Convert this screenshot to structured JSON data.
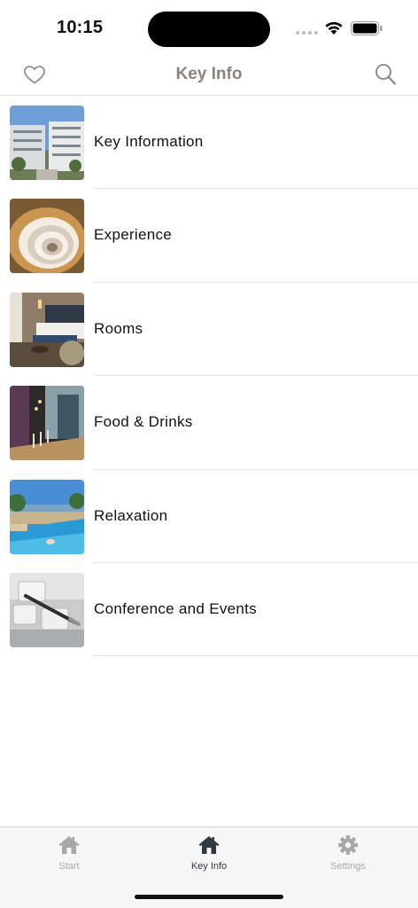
{
  "status_bar": {
    "time": "10:15"
  },
  "nav": {
    "title": "Key Info",
    "favorite_icon": "heart-outline-icon",
    "search_icon": "search-icon"
  },
  "list": {
    "items": [
      {
        "label": "Key Information",
        "thumbnail": "hotel-building-photo"
      },
      {
        "label": "Experience",
        "thumbnail": "spiral-staircase-photo"
      },
      {
        "label": "Rooms",
        "thumbnail": "hotel-room-photo"
      },
      {
        "label": "Food & Drinks",
        "thumbnail": "restaurant-photo"
      },
      {
        "label": "Relaxation",
        "thumbnail": "pool-photo"
      },
      {
        "label": "Conference and Events",
        "thumbnail": "keyboard-pen-photo"
      }
    ]
  },
  "tab_bar": {
    "tabs": [
      {
        "label": "Start",
        "icon": "home-icon",
        "active": false
      },
      {
        "label": "Key Info",
        "icon": "home-icon",
        "active": true
      },
      {
        "label": "Settings",
        "icon": "gear-icon",
        "active": false
      }
    ]
  },
  "colors": {
    "title": "#8f8278",
    "tab_active": "#2e3a44",
    "tab_inactive": "#a8a8a8",
    "divider": "#e3e3e3"
  }
}
